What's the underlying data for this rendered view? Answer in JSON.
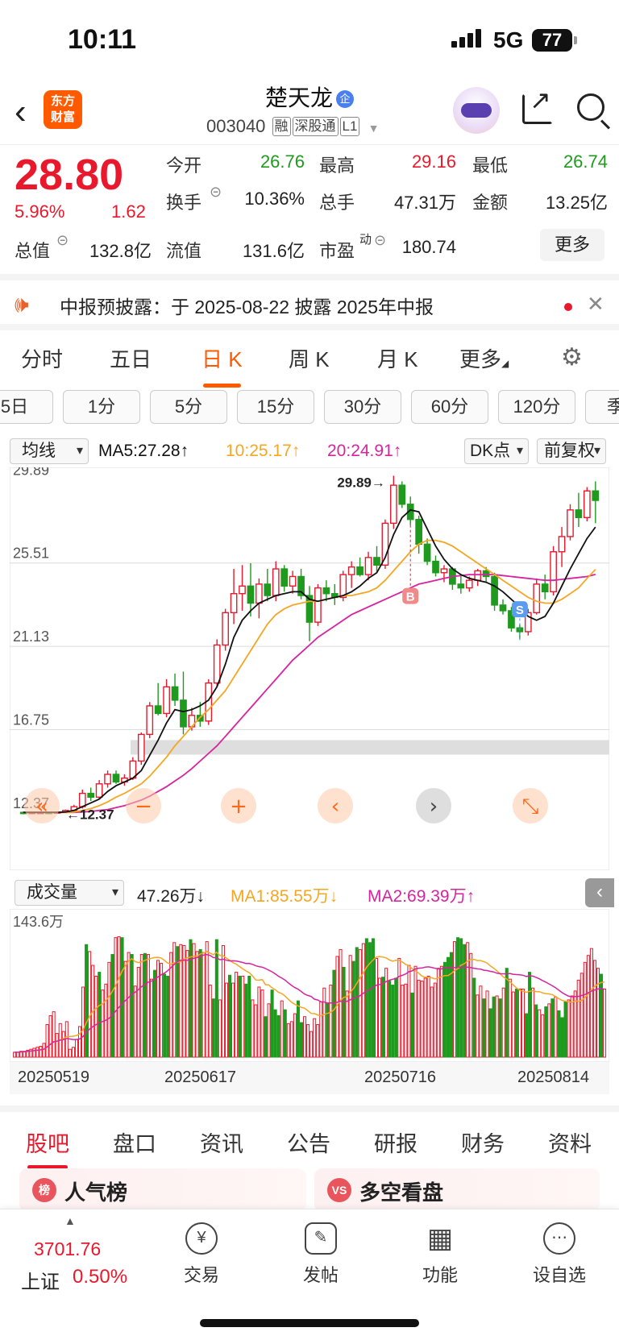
{
  "status": {
    "time": "10:11",
    "network": "5G",
    "battery": "77"
  },
  "header": {
    "logo_line1": "东方",
    "logo_line2": "财富",
    "stock_name": "楚天龙",
    "name_badge": "企",
    "code": "003040",
    "tags": [
      "融",
      "深股通",
      "L1"
    ]
  },
  "quote": {
    "price": "28.80",
    "change_pct": "5.96%",
    "change": "1.62",
    "open_label": "今开",
    "open": "26.76",
    "high_label": "最高",
    "high": "29.16",
    "low_label": "最低",
    "low": "26.74",
    "turnover_label": "换手",
    "turnover": "10.36%",
    "volume_label": "总手",
    "volume": "47.31万",
    "amount_label": "金额",
    "amount": "13.25亿",
    "mktcap_label": "总值",
    "mktcap": "132.8亿",
    "float_label": "流值",
    "float": "131.6亿",
    "pe_label": "市盈",
    "pe_sup": "动",
    "pe": "180.74",
    "more": "更多"
  },
  "notice": {
    "text": "中报预披露：于 2025-08-22 披露 2025年中报"
  },
  "period_tabs": [
    "分时",
    "五日",
    "日 K",
    "周 K",
    "月 K",
    "更多"
  ],
  "period_active": "日 K",
  "intervals": [
    "5日",
    "1分",
    "5分",
    "15分",
    "30分",
    "60分",
    "120分",
    "季"
  ],
  "ma_bar": {
    "selector": "均线",
    "ma5": "MA5:27.28↑",
    "ma10": "10:25.17↑",
    "ma20": "20:24.91↑",
    "dk": "DK点",
    "adjust": "前复权"
  },
  "chart_data": {
    "type": "candlestick",
    "y_ticks": [
      "29.89",
      "25.51",
      "21.13",
      "16.75",
      "12.37"
    ],
    "ylim": [
      11.9,
      30.2
    ],
    "high_label": "29.89→",
    "low_label": "←12.37",
    "markers": [
      {
        "label": "B"
      },
      {
        "label": "S"
      }
    ],
    "candles": [
      [
        12.4,
        12.45,
        12.3,
        12.38
      ],
      [
        12.38,
        12.42,
        12.32,
        12.4
      ],
      [
        12.4,
        12.45,
        12.35,
        12.4
      ],
      [
        12.4,
        12.42,
        12.37,
        12.39
      ],
      [
        12.39,
        12.45,
        12.37,
        12.42
      ],
      [
        12.42,
        12.55,
        12.38,
        12.5
      ],
      [
        12.5,
        12.8,
        12.45,
        12.7
      ],
      [
        12.7,
        13.6,
        12.6,
        13.4
      ],
      [
        13.4,
        13.7,
        13.0,
        13.2
      ],
      [
        13.2,
        14.1,
        13.1,
        13.9
      ],
      [
        13.9,
        14.6,
        13.7,
        14.4
      ],
      [
        14.4,
        14.6,
        13.9,
        14.0
      ],
      [
        14.0,
        14.4,
        13.8,
        14.2
      ],
      [
        14.2,
        15.3,
        14.1,
        15.1
      ],
      [
        15.1,
        16.6,
        14.9,
        16.5
      ],
      [
        16.5,
        18.2,
        16.3,
        18.0
      ],
      [
        18.0,
        19.2,
        17.5,
        17.6
      ],
      [
        17.6,
        19.4,
        17.4,
        19.0
      ],
      [
        19.0,
        19.7,
        18.0,
        18.3
      ],
      [
        18.3,
        19.8,
        16.5,
        16.9
      ],
      [
        16.9,
        17.9,
        16.7,
        17.5
      ],
      [
        17.5,
        18.2,
        16.9,
        17.2
      ],
      [
        17.2,
        19.4,
        17.0,
        19.2
      ],
      [
        19.2,
        21.5,
        19.0,
        21.2
      ],
      [
        21.2,
        23.1,
        20.9,
        22.9
      ],
      [
        22.9,
        25.2,
        22.3,
        23.9
      ],
      [
        23.9,
        25.4,
        23.0,
        24.3
      ],
      [
        24.3,
        25.5,
        22.7,
        23.4
      ],
      [
        23.4,
        24.7,
        22.6,
        24.4
      ],
      [
        24.4,
        25.2,
        23.5,
        23.8
      ],
      [
        23.8,
        25.6,
        23.5,
        25.2
      ],
      [
        25.2,
        25.4,
        24.0,
        24.3
      ],
      [
        24.3,
        25.1,
        23.9,
        24.8
      ],
      [
        24.8,
        25.2,
        23.6,
        23.8
      ],
      [
        23.8,
        24.3,
        21.4,
        22.4
      ],
      [
        22.4,
        24.4,
        22.2,
        24.2
      ],
      [
        24.2,
        24.6,
        23.5,
        23.9
      ],
      [
        23.9,
        24.4,
        23.3,
        23.7
      ],
      [
        23.7,
        25.1,
        23.5,
        24.9
      ],
      [
        24.9,
        25.6,
        24.2,
        25.3
      ],
      [
        25.3,
        25.8,
        24.8,
        24.9
      ],
      [
        24.9,
        26.1,
        24.6,
        25.8
      ],
      [
        25.8,
        26.4,
        25.0,
        25.4
      ],
      [
        25.4,
        27.8,
        25.2,
        27.6
      ],
      [
        27.6,
        30.1,
        27.3,
        29.6
      ],
      [
        29.6,
        29.8,
        28.4,
        28.6
      ],
      [
        28.6,
        29.0,
        27.5,
        27.8
      ],
      [
        27.8,
        28.0,
        26.0,
        26.5
      ],
      [
        26.5,
        26.8,
        25.4,
        25.6
      ],
      [
        25.6,
        25.9,
        24.8,
        25.0
      ],
      [
        25.0,
        25.4,
        24.5,
        25.2
      ],
      [
        25.2,
        25.3,
        24.1,
        24.4
      ],
      [
        24.4,
        24.9,
        23.9,
        24.2
      ],
      [
        24.2,
        24.8,
        24.0,
        24.6
      ],
      [
        24.6,
        25.2,
        24.3,
        25.1
      ],
      [
        25.1,
        25.3,
        24.5,
        24.8
      ],
      [
        24.8,
        25.0,
        23.0,
        23.3
      ],
      [
        23.3,
        23.6,
        22.8,
        23.0
      ],
      [
        23.0,
        23.2,
        21.9,
        22.1
      ],
      [
        22.1,
        22.3,
        21.5,
        21.9
      ],
      [
        21.9,
        23.1,
        21.7,
        22.9
      ],
      [
        22.9,
        24.7,
        22.8,
        24.4
      ],
      [
        24.4,
        24.9,
        23.6,
        24.0
      ],
      [
        24.0,
        26.4,
        23.8,
        26.1
      ],
      [
        26.1,
        27.4,
        25.3,
        26.9
      ],
      [
        26.9,
        28.6,
        26.7,
        28.3
      ],
      [
        28.3,
        29.2,
        27.4,
        27.9
      ],
      [
        27.9,
        29.5,
        27.7,
        29.3
      ],
      [
        29.3,
        29.8,
        27.6,
        28.8
      ]
    ],
    "ma5": [
      12.4,
      12.4,
      12.4,
      12.4,
      12.4,
      12.42,
      12.5,
      12.7,
      12.9,
      13.1,
      13.5,
      13.8,
      14.0,
      14.2,
      14.6,
      15.4,
      16.2,
      17.1,
      17.8,
      17.7,
      17.8,
      18.0,
      18.3,
      19.0,
      20.2,
      21.6,
      22.5,
      23.0,
      23.4,
      23.6,
      23.8,
      23.9,
      24.0,
      24.0,
      23.6,
      23.5,
      23.6,
      23.7,
      23.8,
      24.0,
      24.3,
      24.7,
      25.0,
      25.8,
      27.0,
      27.9,
      28.3,
      28.2,
      27.3,
      26.4,
      25.7,
      25.2,
      24.9,
      24.7,
      24.6,
      24.5,
      24.3,
      24.0,
      23.6,
      23.2,
      22.7,
      22.5,
      22.7,
      23.4,
      24.3,
      25.2,
      26.0,
      26.8,
      27.4
    ],
    "ma10": [
      12.4,
      12.4,
      12.4,
      12.4,
      12.4,
      12.4,
      12.42,
      12.5,
      12.6,
      12.75,
      12.95,
      13.2,
      13.4,
      13.65,
      13.9,
      14.3,
      14.8,
      15.3,
      15.9,
      16.4,
      16.9,
      17.4,
      17.8,
      18.3,
      18.8,
      19.5,
      20.2,
      20.9,
      21.6,
      22.3,
      22.8,
      23.1,
      23.3,
      23.4,
      23.5,
      23.5,
      23.6,
      23.7,
      23.8,
      23.8,
      23.9,
      24.0,
      24.2,
      24.6,
      25.1,
      25.6,
      26.1,
      26.5,
      26.7,
      26.7,
      26.6,
      26.4,
      26.1,
      25.8,
      25.5,
      25.2,
      24.9,
      24.6,
      24.3,
      24.0,
      23.7,
      23.5,
      23.4,
      23.4,
      23.6,
      23.9,
      24.2,
      24.7,
      25.17
    ],
    "ma20": [
      12.4,
      12.4,
      12.4,
      12.4,
      12.4,
      12.4,
      12.4,
      12.42,
      12.45,
      12.5,
      12.55,
      12.65,
      12.75,
      12.9,
      13.05,
      13.25,
      13.5,
      13.75,
      14.05,
      14.35,
      14.7,
      15.1,
      15.5,
      15.9,
      16.4,
      16.9,
      17.4,
      17.9,
      18.4,
      18.9,
      19.4,
      19.9,
      20.4,
      20.8,
      21.2,
      21.6,
      21.9,
      22.2,
      22.5,
      22.8,
      23.0,
      23.2,
      23.4,
      23.6,
      23.8,
      24.0,
      24.2,
      24.4,
      24.5,
      24.6,
      24.7,
      24.8,
      24.85,
      24.9,
      24.9,
      24.9,
      24.9,
      24.85,
      24.8,
      24.75,
      24.7,
      24.65,
      24.6,
      24.6,
      24.65,
      24.7,
      24.75,
      24.8,
      24.91
    ]
  },
  "controls": [
    "«",
    "−",
    "+",
    "‹",
    "›",
    "⤡"
  ],
  "vol_bar": {
    "selector": "成交量",
    "vol": "47.26万↓",
    "ma1": "MA1:85.55万↓",
    "ma2": "MA2:69.39万↑"
  },
  "vol_data": {
    "max_label": "143.6万",
    "max": 143.6,
    "values": [
      5,
      5,
      6,
      6,
      7,
      8,
      9,
      10,
      11,
      14,
      33,
      42,
      46,
      24,
      34,
      26,
      36,
      8,
      10,
      18,
      31,
      71,
      114,
      107,
      93,
      82,
      86,
      68,
      74,
      96,
      104,
      121,
      122,
      121,
      97,
      106,
      104,
      72,
      91,
      104,
      105,
      104,
      79,
      88,
      98,
      95,
      84,
      82,
      106,
      116,
      112,
      114,
      113,
      108,
      119,
      115,
      107,
      109,
      106,
      117,
      73,
      59,
      119,
      58,
      113,
      75,
      83,
      75,
      86,
      82,
      82,
      74,
      82,
      58,
      53,
      71,
      68,
      41,
      54,
      68,
      48,
      42,
      57,
      48,
      34,
      36,
      44,
      57,
      35,
      41,
      33,
      26,
      39,
      33,
      56,
      70,
      55,
      73,
      88,
      102,
      109,
      91,
      67,
      103,
      97,
      111,
      109,
      115,
      120,
      116,
      120,
      100,
      80,
      81,
      90,
      77,
      73,
      80,
      100,
      73,
      74,
      93,
      65,
      92,
      78,
      77,
      80,
      82,
      71,
      75,
      90,
      92,
      96,
      101,
      106,
      117,
      121,
      120,
      114,
      116,
      105,
      80,
      63,
      72,
      59,
      67,
      49,
      61,
      62,
      59,
      70,
      90,
      79,
      66,
      69,
      69,
      69,
      44,
      86,
      70,
      53,
      48,
      43,
      51,
      54,
      59,
      61,
      47,
      40,
      56,
      58,
      62,
      67,
      78,
      85,
      96,
      103,
      110,
      98,
      90,
      84,
      69
    ],
    "colors": "rrrrrrrrrrrrrrrrrrrrrrgrrrgrrrgrrgrrgrrrgrrgrrggrrgrrrgrrgrrrggrrrgrrgrggrrrrgrgggrgrrrggrrrrrrrgrgrrgrrggrrgggrrgrgggrrrrgrrrrrrrrrgggrgggrrgrrgrggrgrgrrgrrggrgrrgrgrgggrrrrrrrrrrgrgrgrgrrgr",
    "ma1": [],
    "ma2": []
  },
  "dates": [
    "20250519",
    "20250617",
    "20250716",
    "20250814"
  ],
  "bottom_tabs": [
    "股吧",
    "盘口",
    "资讯",
    "公告",
    "研报",
    "财务",
    "资料"
  ],
  "bottom_active": "股吧",
  "cards": [
    {
      "icon": "榜",
      "title": "人气榜"
    },
    {
      "icon": "VS",
      "title": "多空看盘"
    }
  ],
  "index": {
    "value": "3701.76",
    "name": "上证",
    "pct": "0.50%"
  },
  "nav": [
    {
      "icon": "¥",
      "label": "交易"
    },
    {
      "icon": "✎",
      "label": "发帖"
    },
    {
      "icon": "▦",
      "label": "功能"
    },
    {
      "icon": "⋯",
      "label": "设自选"
    }
  ],
  "colors": {
    "up": "#e8192c",
    "down": "#1f9a1f",
    "ma5": "#111111",
    "ma10": "#f5a623",
    "ma20": "#d6249f",
    "accent": "#ff5a00"
  }
}
